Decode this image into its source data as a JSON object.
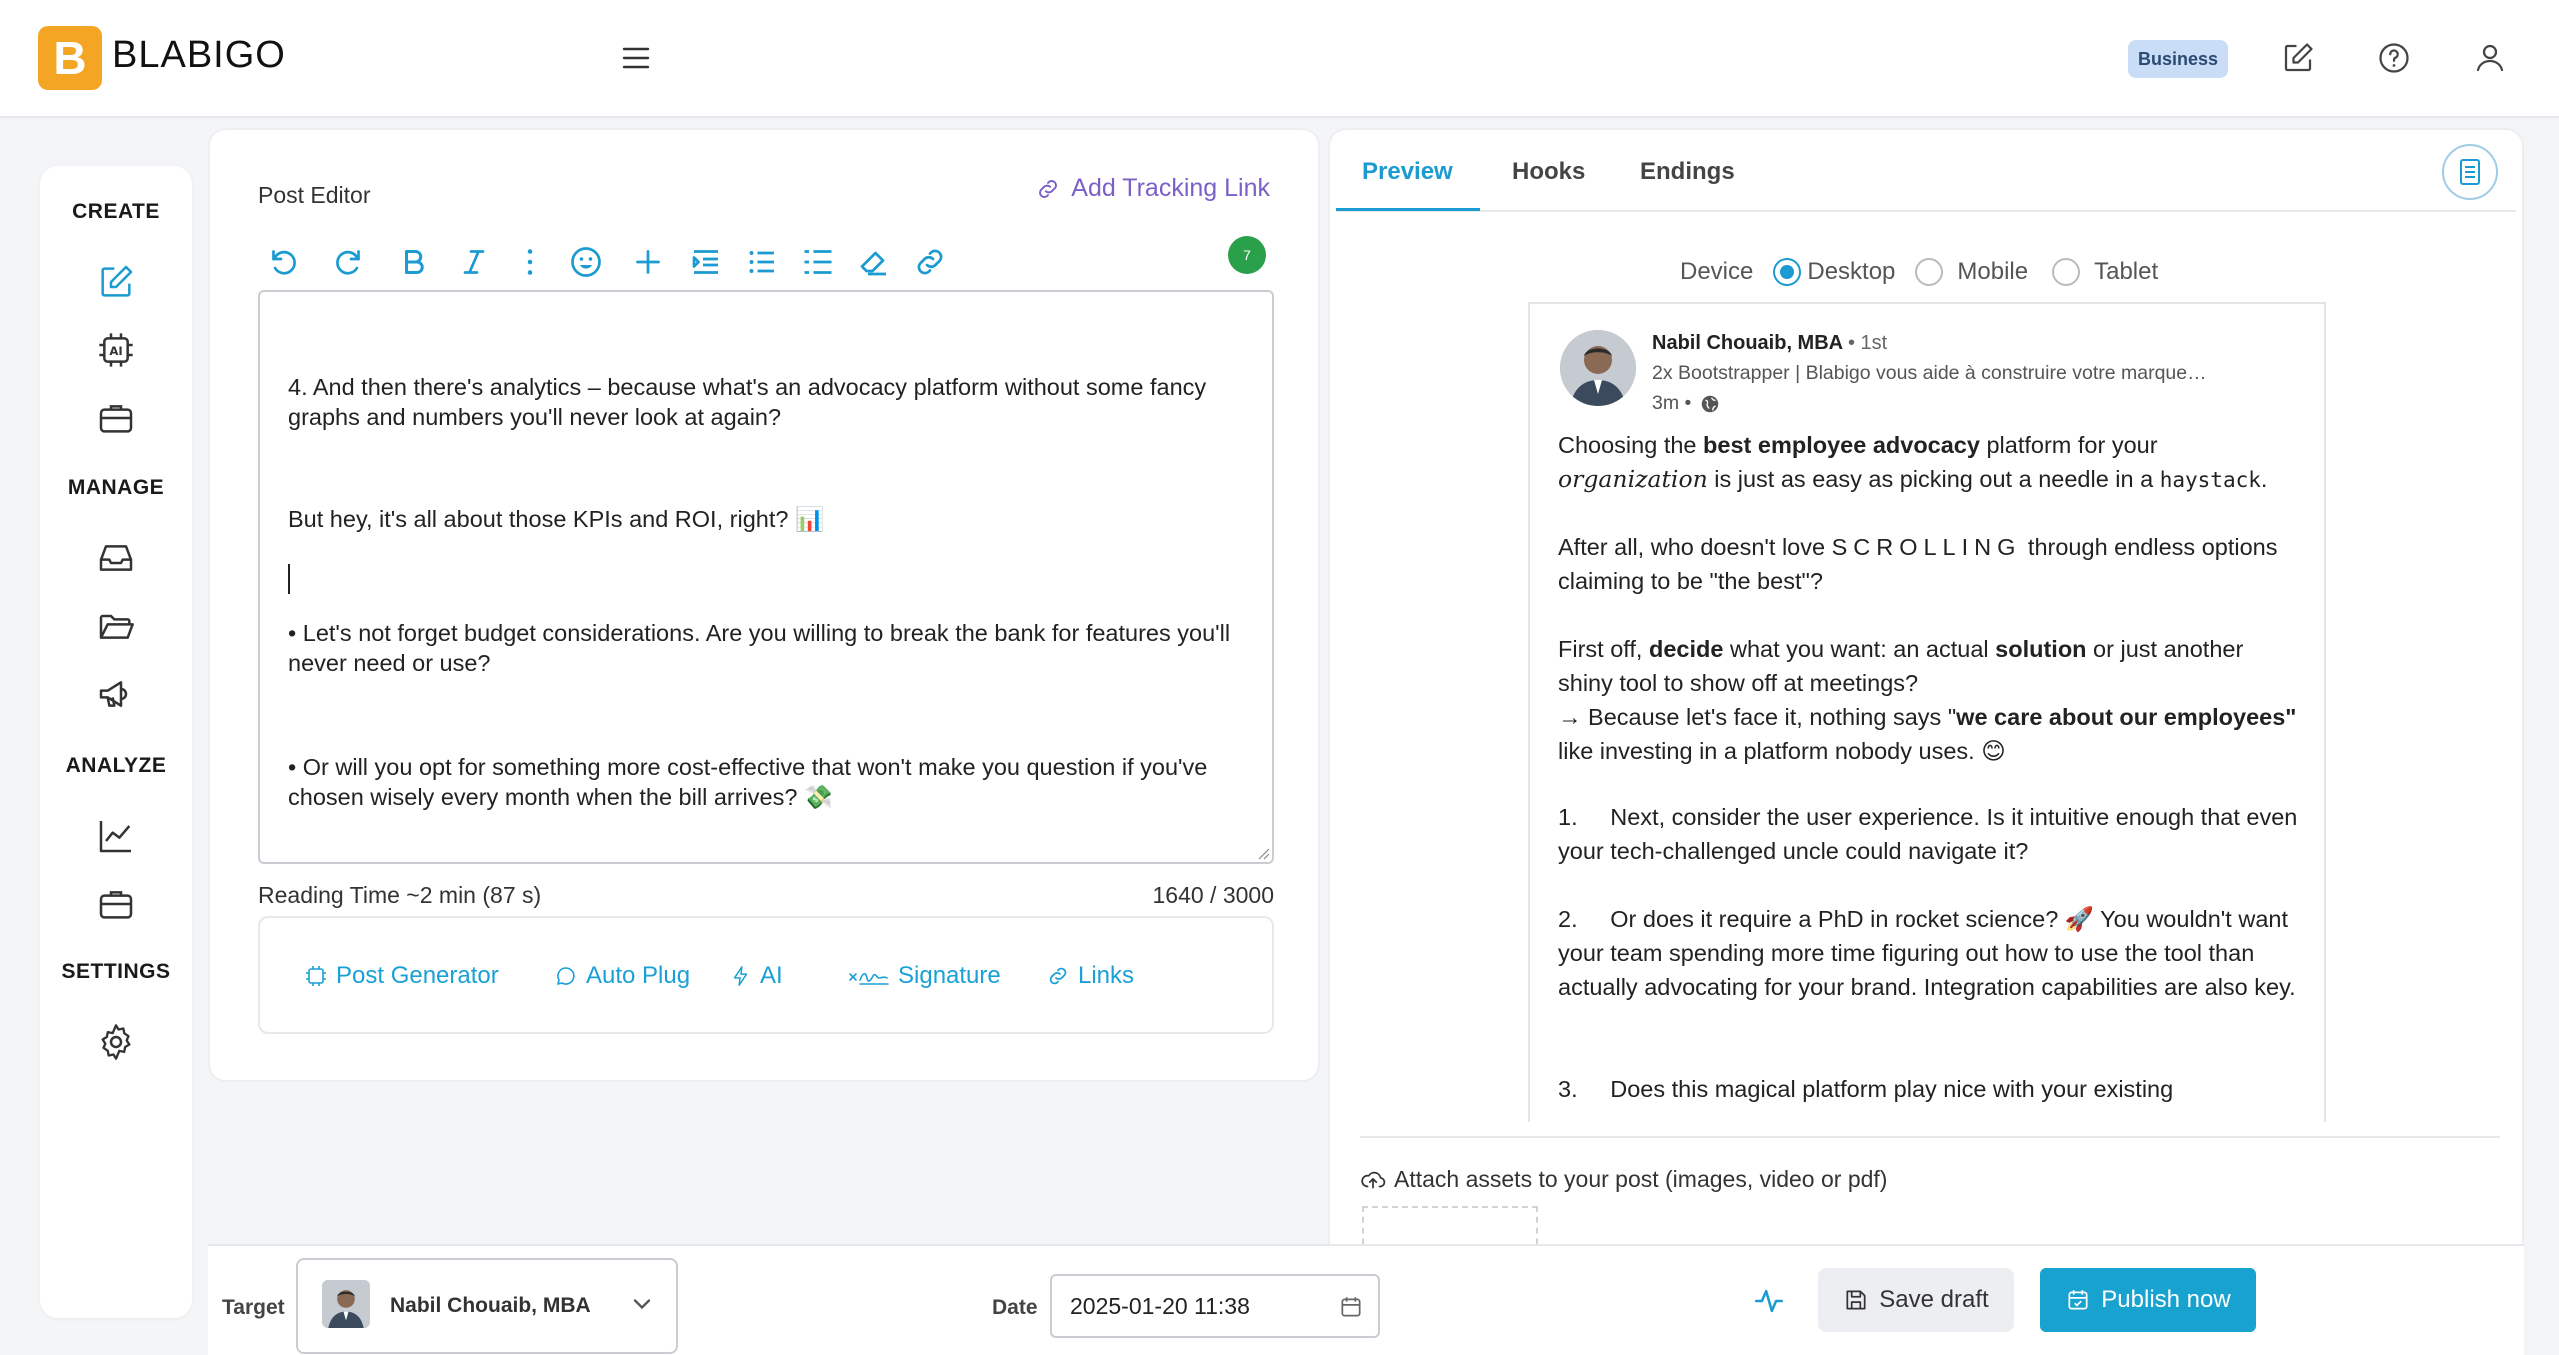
{
  "header": {
    "logo_letter": "B",
    "brand": "BLABIGO",
    "plan_badge": "Business"
  },
  "nav": {
    "create": "CREATE",
    "manage": "MANAGE",
    "analyze": "ANALYZE",
    "settings": "SETTINGS"
  },
  "editor": {
    "title": "Post Editor",
    "tracking_link": "Add Tracking Link",
    "char_badge": "7",
    "paragraphs": [
      "4. And then there's analytics – because what's an advocacy platform without some fancy graphs and numbers you'll never look at again?",
      "But hey, it's all about those KPIs and ROI, right? 📊",
      "• Let's not forget budget considerations. Are you willing to break the bank for features you'll never need or use?",
      "• Or will you opt for something more cost-effective that won't make you question if you've chosen wisely every month when the bill arrives? 💸"
    ],
    "reading_time": "Reading Time ~2 min (87 s)",
    "char_count": "1640 / 3000",
    "actions": {
      "post_generator": "Post Generator",
      "auto_plug": "Auto Plug",
      "ai": "AI",
      "signature": "Signature",
      "links": "Links"
    }
  },
  "preview": {
    "tabs": {
      "preview": "Preview",
      "hooks": "Hooks",
      "endings": "Endings"
    },
    "device_label": "Device",
    "devices": {
      "desktop": "Desktop",
      "mobile": "Mobile",
      "tablet": "Tablet"
    },
    "selected_device": "Desktop",
    "post": {
      "author": "Nabil Chouaib, MBA",
      "degree": "• 1st",
      "headline": "2x Bootstrapper | Blabigo vous aide à construire votre marque…",
      "time": "3m •",
      "p1_a": "Choosing the ",
      "p1_b": "best employee advocacy",
      "p1_c": " platform for your ",
      "p1_d": "organization",
      "p1_e": " is just as easy as picking out a needle in a ",
      "p1_f": "haystack",
      "p1_g": ".",
      "p2_a": "After all, who doesn't love ",
      "p2_b": "SCROLLING",
      "p2_c": " through endless options claiming to be \"the best\"?",
      "p3_a": "First off, ",
      "p3_b": "decide",
      "p3_c": " what you want: an actual ",
      "p3_d": "solution",
      "p3_e": " or just another shiny tool to show off at meetings?",
      "p3_f": "→ Because let's face it, nothing says \"",
      "p3_g": "we care about our employees\"",
      "p3_h": " like investing in a platform nobody uses. 😊",
      "p4": "1.     Next, consider the user experience. Is it intuitive enough that even your tech-challenged uncle could navigate it?",
      "p5": "2.     Or does it require a PhD in rocket science? 🚀 You wouldn't want your team spending more time figuring out how to use the tool than actually advocating for your brand. Integration capabilities are also key.",
      "p6": "3.     Does this magical platform play nice with your existing"
    },
    "attach": "Attach assets to your post (images, video or pdf)"
  },
  "footer": {
    "target_label": "Target",
    "target_value": "Nabil Chouaib, MBA",
    "date_label": "Date",
    "date_value": "2025-01-20  11:38",
    "save_draft": "Save draft",
    "publish": "Publish now"
  },
  "colors": {
    "accent": "#1b9bd1",
    "brand": "#f5a524",
    "tracking": "#7b61c7",
    "badge_bg": "#c9ddf7",
    "counter": "#2aa04a"
  }
}
